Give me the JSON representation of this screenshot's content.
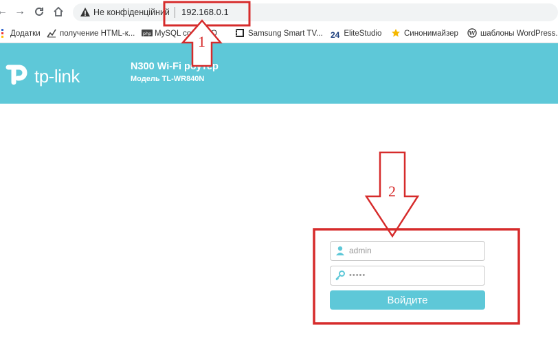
{
  "browser": {
    "security_label": "Не конфіденційний",
    "url": "192.168.0.1"
  },
  "bookmarks": [
    {
      "label": "Додатки",
      "icon": "apps-grid-icon"
    },
    {
      "label": "получение HTML-к...",
      "icon": "chart-icon"
    },
    {
      "label": "MySQL co... PDO",
      "icon": "php-icon"
    },
    {
      "label": "Samsung Smart TV...",
      "icon": "film-icon"
    },
    {
      "label": "EliteStudio",
      "icon": "24-icon",
      "icon_text": "24"
    },
    {
      "label": "Синонимайзер",
      "icon": "star-icon"
    },
    {
      "label": "шаблоны WordPress...",
      "icon": "wordpress-icon"
    }
  ],
  "router": {
    "brand": "tp-link",
    "model_title": "N300 Wi-Fi роутер",
    "model_subtitle": "Модель TL-WR840N"
  },
  "login": {
    "username_value": "admin",
    "password_value": "•••••",
    "submit_label": "Войдите"
  },
  "annotations": {
    "step1": "1",
    "step2": "2",
    "color": "#d62b2b"
  },
  "colors": {
    "accent": "#5ec8d8"
  }
}
